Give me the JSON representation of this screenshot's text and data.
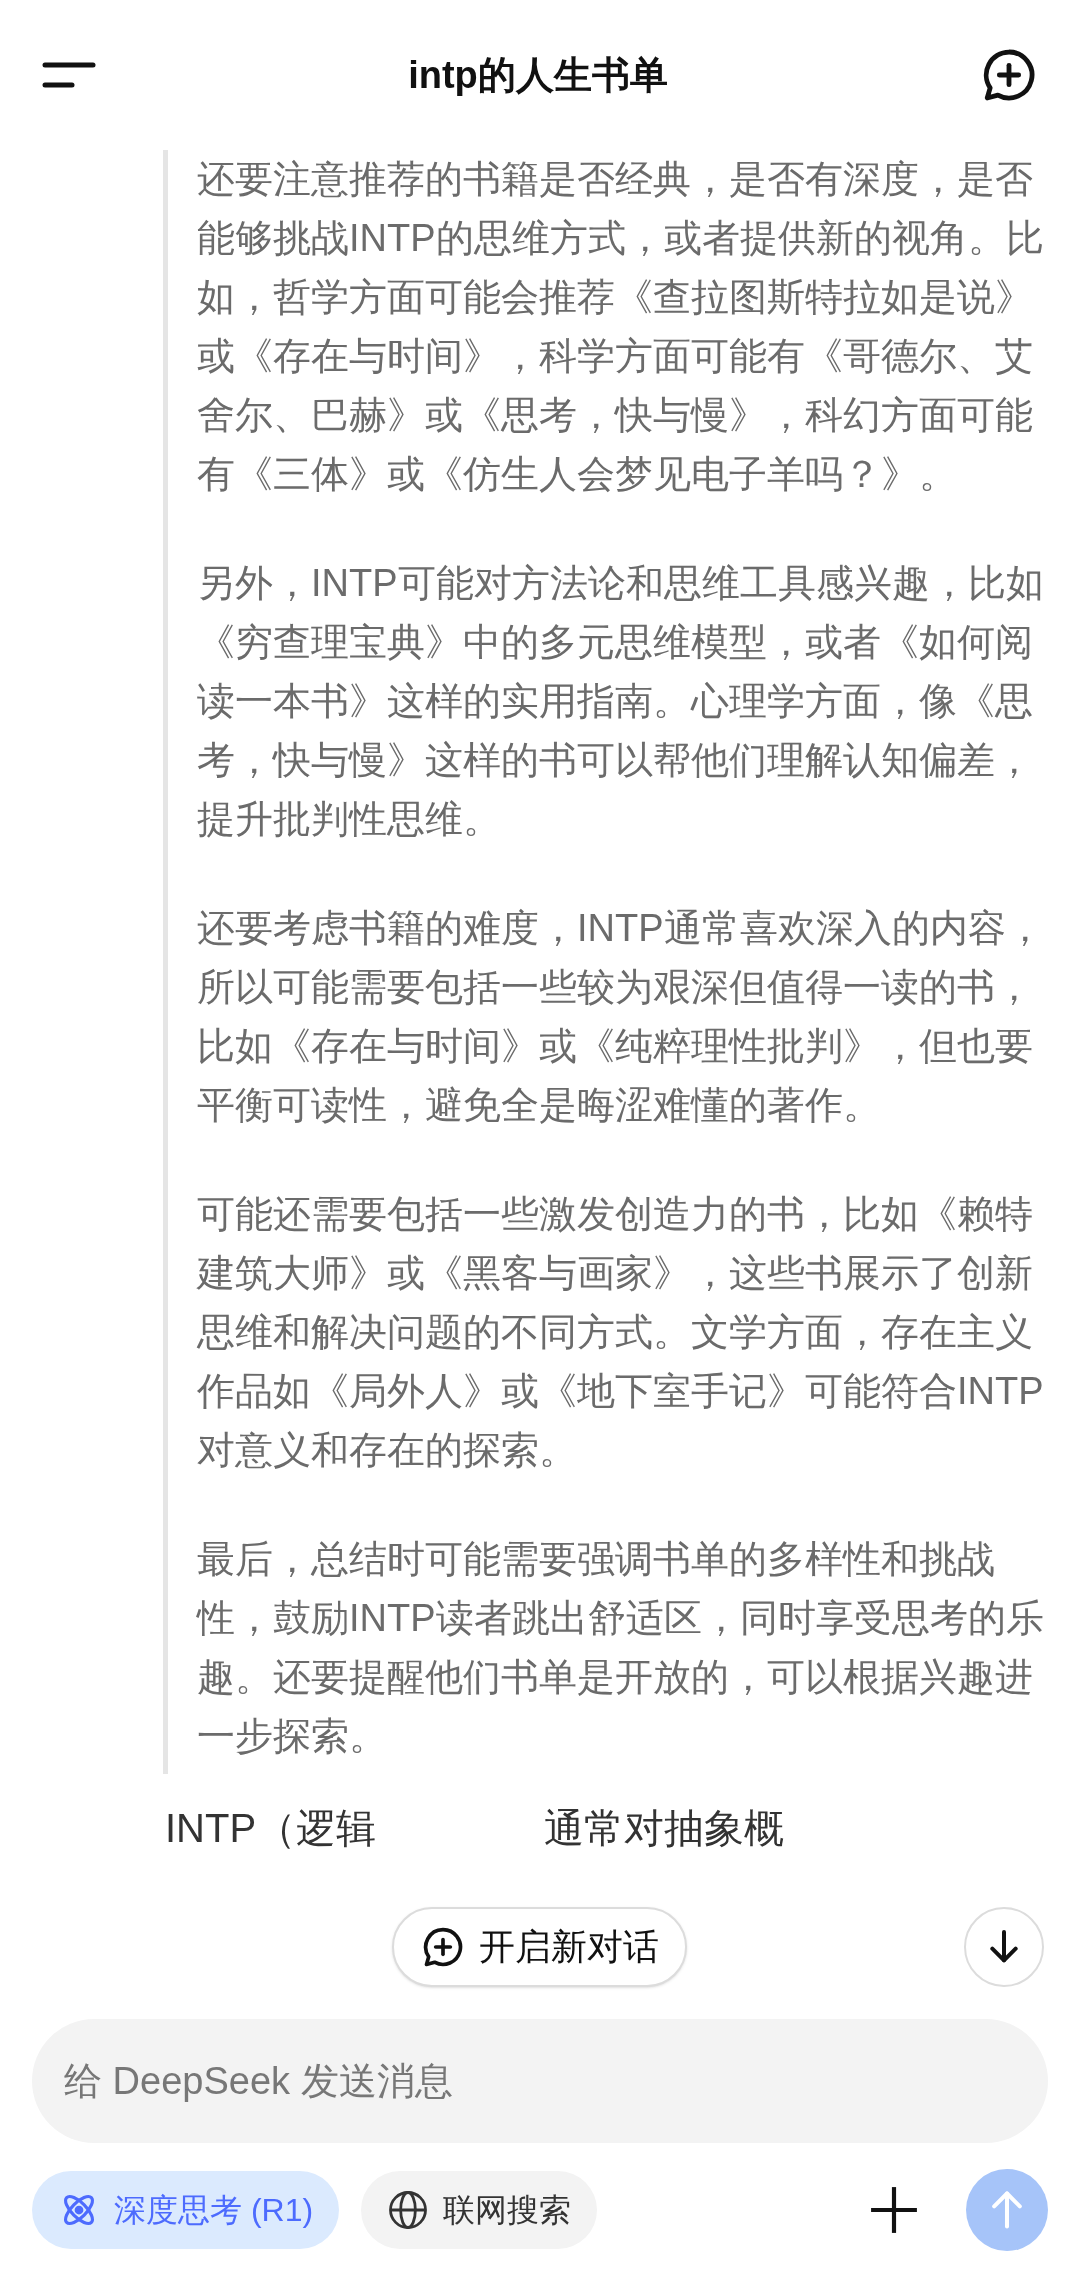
{
  "header": {
    "title": "intp的人生书单"
  },
  "thinking": {
    "paragraphs": [
      "还要注意推荐的书籍是否经典，是否有深度，是否能够挑战INTP的思维方式，或者提供新的视角。比如，哲学方面可能会推荐《查拉图斯特拉如是说》或《存在与时间》，科学方面可能有《哥德尔、艾舍尔、巴赫》或《思考，快与慢》，科幻方面可能有《三体》或《仿生人会梦见电子羊吗？》。",
      "另外，INTP可能对方法论和思维工具感兴趣，比如《穷查理宝典》中的多元思维模型，或者《如何阅读一本书》这样的实用指南。心理学方面，像《思考，快与慢》这样的书可以帮他们理解认知偏差，提升批判性思维。",
      "还要考虑书籍的难度，INTP通常喜欢深入的内容，所以可能需要包括一些较为艰深但值得一读的书，比如《存在与时间》或《纯粹理性批判》，但也要平衡可读性，避免全是晦涩难懂的著作。",
      "可能还需要包括一些激发创造力的书，比如《赖特建筑大师》或《黑客与画家》，这些书展示了创新思维和解决问题的不同方式。文学方面，存在主义作品如《局外人》或《地下室手记》可能符合INTP对意义和存在的探索。",
      "最后，总结时可能需要强调书单的多样性和挑战性，鼓励INTP读者跳出舒适区，同时享受思考的乐趣。还要提醒他们书单是开放的，可以根据兴趣进一步探索。"
    ]
  },
  "answer": {
    "segments": [
      "INTP（逻辑",
      "通常对抽象概"
    ]
  },
  "float_actions": {
    "new_chat": "开启新对话"
  },
  "composer": {
    "placeholder": "给 DeepSeek 发送消息",
    "send_disabled": true,
    "toggles": [
      {
        "kind": "deep_think",
        "label": "深度思考 (R1)",
        "selected": true
      },
      {
        "kind": "web_search",
        "label": "联网搜索",
        "selected": false
      }
    ]
  }
}
